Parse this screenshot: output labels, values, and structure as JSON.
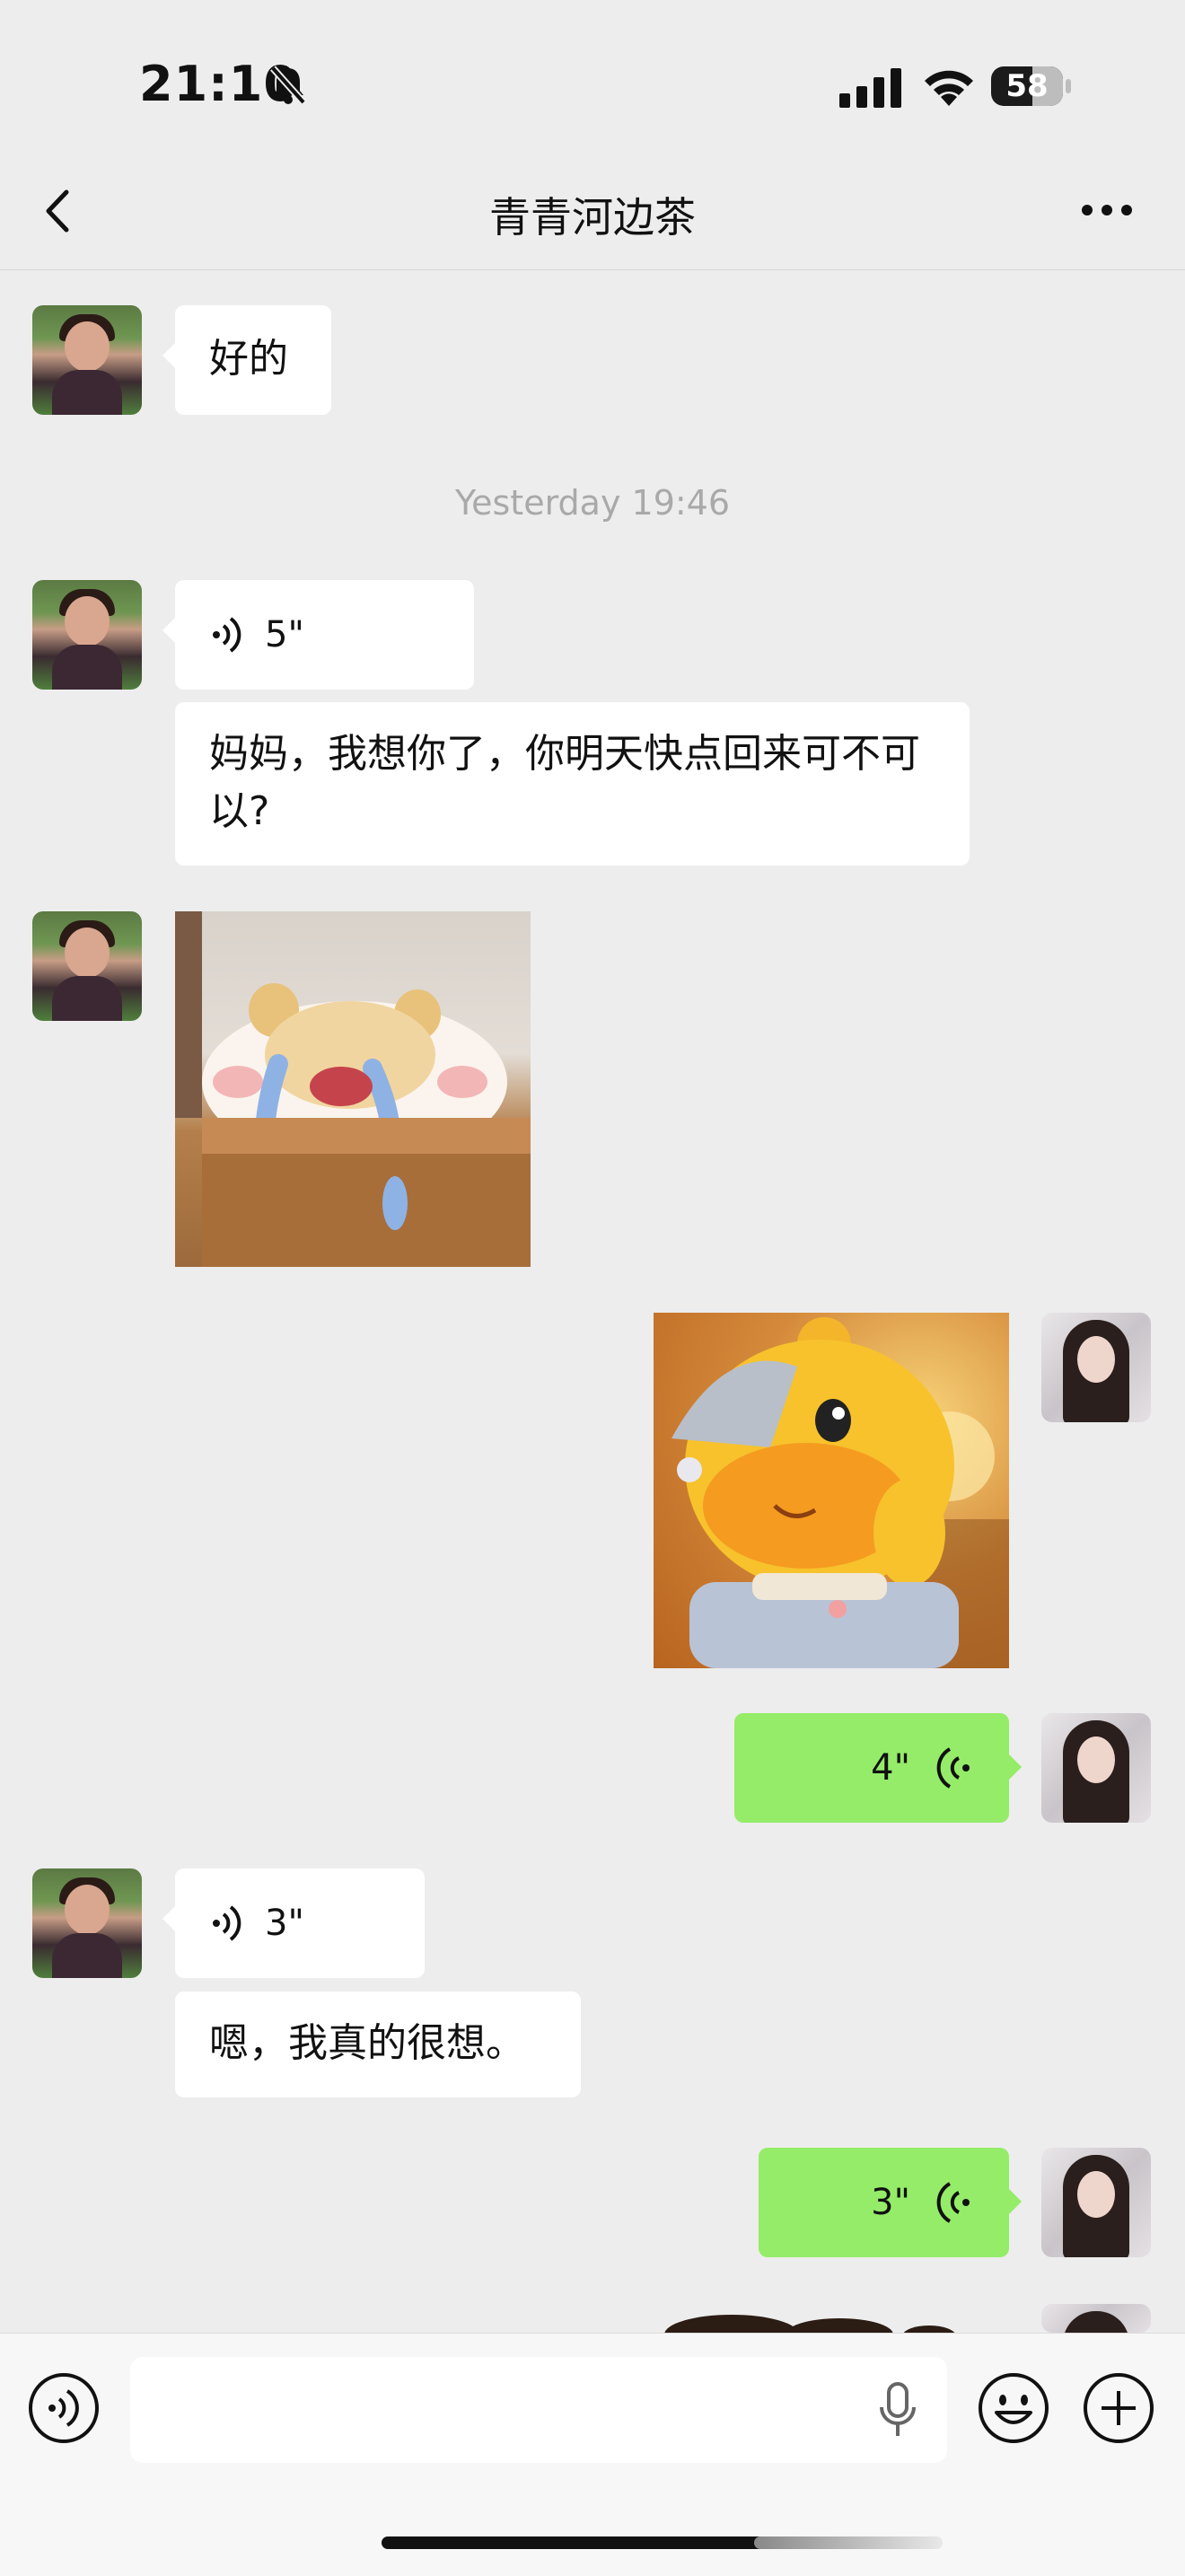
{
  "status_bar": {
    "time": "21:10",
    "battery": "58",
    "battery_level_percent": 58
  },
  "header": {
    "title": "青青河边茶"
  },
  "messages": [
    {
      "side": "left",
      "type": "text",
      "text": "好的"
    },
    {
      "type": "timestamp",
      "text": "Yesterday 19:46"
    },
    {
      "side": "left",
      "type": "voice",
      "duration": "5\""
    },
    {
      "side": "left",
      "type": "text",
      "text": "妈妈，我想你了，你明天快点回来可不可以?"
    },
    {
      "side": "left",
      "type": "sticker",
      "icon": "crying-bear-sticker"
    },
    {
      "side": "right",
      "type": "sticker",
      "icon": "duck-sticker"
    },
    {
      "side": "right",
      "type": "voice",
      "duration": "4\""
    },
    {
      "side": "left",
      "type": "voice",
      "duration": "3\""
    },
    {
      "side": "left",
      "type": "text",
      "text": "嗯，我真的很想。"
    },
    {
      "side": "right",
      "type": "voice",
      "duration": "3\""
    }
  ],
  "colors": {
    "background": "#ededed",
    "bubble_mine": "#95ec69",
    "bubble_other": "#ffffff"
  },
  "input_bar": {
    "value": "",
    "icons": [
      "voice-toggle-icon",
      "microphone-icon",
      "emoji-icon",
      "plus-icon"
    ]
  }
}
